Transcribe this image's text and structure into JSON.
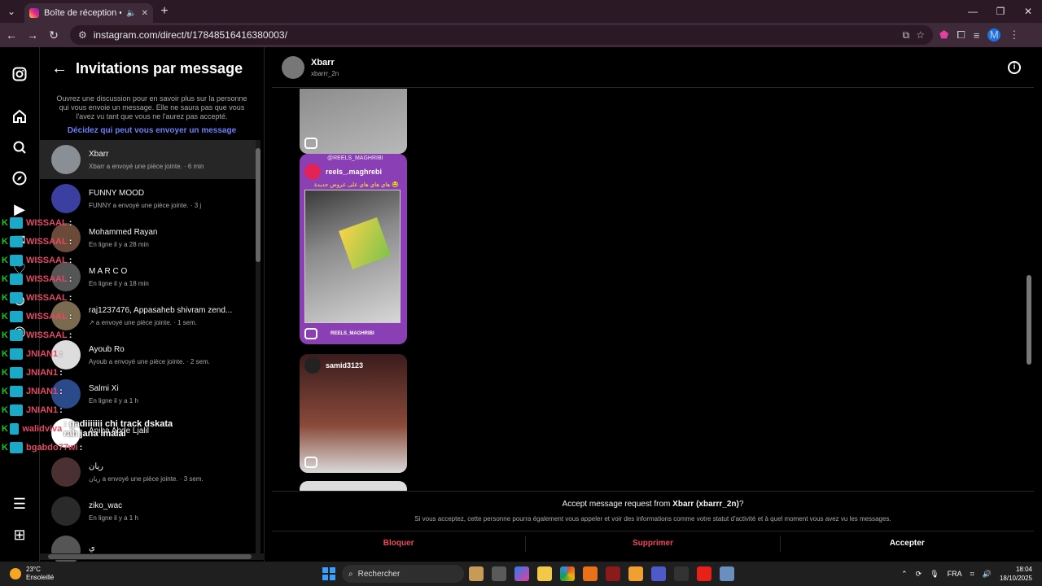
{
  "browser": {
    "tab_title": "Boîte de réception • Direct",
    "url": "instagram.com/direct/t/17848516416380003/",
    "profile_initial": "M"
  },
  "requests": {
    "title": "Invitations par message",
    "description": "Ouvrez une discussion pour en savoir plus sur la personne qui vous envoie un message. Elle ne saura pas que vous l'avez vu tant que vous ne l'aurez pas accepté.",
    "link": "Décidez qui peut vous envoyer un message",
    "items": [
      {
        "name": "Xbarr",
        "sub": "Xbarr a envoyé une pièce jointe. · 6 min"
      },
      {
        "name": "FUNNY MOOD",
        "sub": "FUNNY a envoyé une pièce jointe. · 3 j"
      },
      {
        "name": "Mohammed Rayan",
        "sub": "En ligne il y a 28 min"
      },
      {
        "name": "M A R C O",
        "sub": "En ligne il y a 18 min"
      },
      {
        "name": "raj1237476, Appasaheb shivram zend...",
        "sub": "↗ a envoyé une pièce jointe. · 1 sem."
      },
      {
        "name": "Ayoub Ro",
        "sub": "Ayoub a envoyé une pièce jointe. · 2 sem."
      },
      {
        "name": "Salmi Xi",
        "sub": "En ligne il y a 1 h"
      },
      {
        "name": "Aniba Abde Ljalil",
        "sub": ""
      },
      {
        "name": "ريان",
        "sub": "ريان a envoyé une pièce jointe. · 3 sem."
      },
      {
        "name": "ziko_wac",
        "sub": "En ligne il y a 1 h"
      },
      {
        "name": "ي",
        "sub": ""
      }
    ]
  },
  "overlay": [
    {
      "user": "WISSAAL",
      "msg": ":"
    },
    {
      "user": "WISSAAL",
      "msg": ":"
    },
    {
      "user": "WISSAAL",
      "msg": ":"
    },
    {
      "user": "WISSAAL",
      "msg": ":"
    },
    {
      "user": "WISSAAL",
      "msg": ":"
    },
    {
      "user": "WISSAAL",
      "msg": ":"
    },
    {
      "user": "WISSAAL",
      "msg": ":"
    },
    {
      "user": "JNIAN1",
      "msg": ":"
    },
    {
      "user": "JNIAN1",
      "msg": ":"
    },
    {
      "user": "JNIAN1",
      "msg": ":"
    },
    {
      "user": "JNIAN1",
      "msg": ":"
    },
    {
      "user": "walidviva",
      "msg": ": gadiiiiiii chi track dskata rah jana lmalal"
    },
    {
      "user": "bgabdo77wi",
      "msg": ":"
    }
  ],
  "conversation": {
    "name": "Xbarr",
    "username": "xbarrr_2n",
    "card2_top_handle": "@REELS_MAGHRIBI",
    "card2_account": "reels_.maghrebi",
    "card2_arabic": "هاي هاي هاي على عروض جديدة 😂",
    "card2_bottom_handle": "REELS_MAGHRIBI",
    "card3_account": "samid3123"
  },
  "request_bar": {
    "question_prefix": "Accept message request from ",
    "question_user": "Xbarr (xbarrr_2n)",
    "question_suffix": "?",
    "description": "Si vous acceptez, cette personne pourra également vous appeler et voir des informations comme votre statut d'activité et à quel moment vous avez vu les messages.",
    "block": "Bloquer",
    "delete": "Supprimer",
    "accept": "Accepter"
  },
  "taskbar": {
    "temp": "23°C",
    "weather": "Ensoleillé",
    "search": "Rechercher",
    "lang": "FRA",
    "time": "18:04",
    "date": "18/10/2025"
  },
  "colors": {
    "link_blue": "#6a80f8",
    "danger_red": "#ed4956",
    "overlay_user": "#e24a63",
    "overlay_k": "#19c919"
  }
}
